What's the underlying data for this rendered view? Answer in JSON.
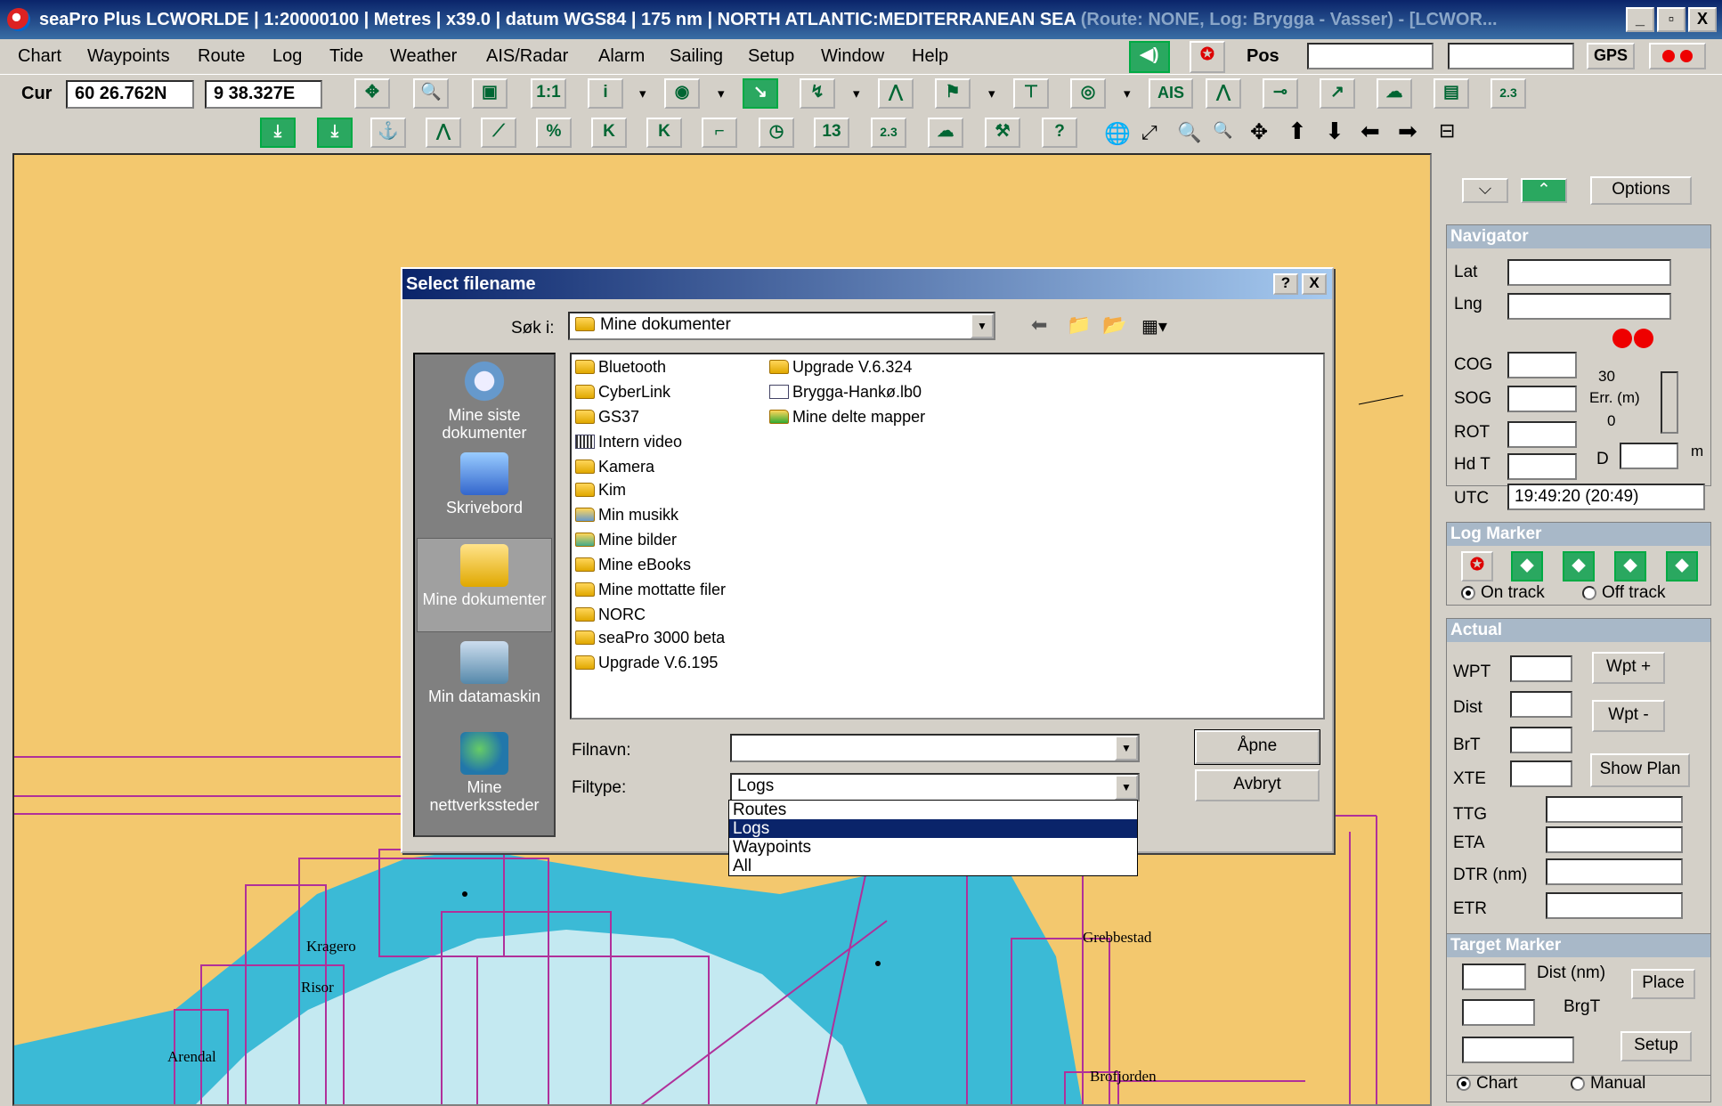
{
  "window": {
    "title": "seaPro Plus LCWORLDE | 1:20000100 | Metres | x39.0 | datum WGS84 | 175 nm | NORTH ATLANTIC:MEDITERRANEAN SEA",
    "title_dim": " (Route: NONE, Log: Brygga - Vasser) - [LCWOR...",
    "controls": [
      "_",
      "▫",
      "X"
    ]
  },
  "menu": {
    "items": [
      "Chart",
      "Waypoints",
      "Route",
      "Log",
      "Tide",
      "Weather",
      "AIS/Radar",
      "Alarm",
      "Sailing",
      "Setup",
      "Window",
      "Help"
    ],
    "pos_label": "Pos",
    "gps_label": "GPS"
  },
  "toolbar": {
    "cur_label": "Cur",
    "lat": "60 26.762N",
    "lng": "9 38.327E",
    "ais_label": "AIS",
    "btn_13": "13",
    "btn_23": "2.3"
  },
  "chart": {
    "places": [
      "Kragero",
      "Risor",
      "Arendal",
      "Grebbestad",
      "Brofjorden"
    ]
  },
  "panel": {
    "options": "Options",
    "navigator": {
      "title": "Navigator",
      "lat": "Lat",
      "lng": "Lng",
      "cog": "COG",
      "sog": "SOG",
      "rot": "ROT",
      "hdt": "Hd T",
      "utc": "UTC",
      "err_top": "30",
      "err_label": "Err. (m)",
      "err_bottom": "0",
      "d_label": "D",
      "m_label": "m",
      "utc_value": "19:49:20  (20:49)"
    },
    "log_marker": {
      "title": "Log Marker",
      "on_track": "On track",
      "off_track": "Off track"
    },
    "actual": {
      "title": "Actual",
      "wpt": "WPT",
      "dist": "Dist",
      "brt": "BrT",
      "xte": "XTE",
      "ttg": "TTG",
      "eta": "ETA",
      "dtr": "DTR (nm)",
      "etr": "ETR",
      "wpt_plus": "Wpt +",
      "wpt_minus": "Wpt -",
      "show_plan": "Show Plan"
    },
    "target": {
      "title": "Target Marker",
      "dist": "Dist (nm)",
      "brgt": "BrgT",
      "place": "Place",
      "setup": "Setup",
      "chart": "Chart",
      "manual": "Manual"
    }
  },
  "dialog": {
    "title": "Select filename",
    "help": "?",
    "close": "X",
    "look_in_label": "Søk i:",
    "look_in_value": "Mine dokumenter",
    "places": [
      "Mine siste dokumenter",
      "Skrivebord",
      "Mine dokumenter",
      "Min datamaskin",
      "Mine nettverkssteder"
    ],
    "files_col1": [
      "Bluetooth",
      "CyberLink",
      "GS37",
      "Intern video",
      "Kamera",
      "Kim",
      "Min musikk",
      "Mine bilder",
      "Mine eBooks",
      "Mine mottatte filer",
      "NORC",
      "seaPro 3000 beta",
      "Upgrade V.6.195"
    ],
    "files_col2": [
      "Upgrade V.6.324",
      "Brygga-Hankø.lb0",
      "Mine delte mapper"
    ],
    "filename_label": "Filnavn:",
    "filename_value": "",
    "filetype_label": "Filtype:",
    "filetype_value": "Logs",
    "filetype_options": [
      "Routes",
      "Logs",
      "Waypoints",
      "All"
    ],
    "open": "Åpne",
    "cancel": "Avbryt"
  }
}
